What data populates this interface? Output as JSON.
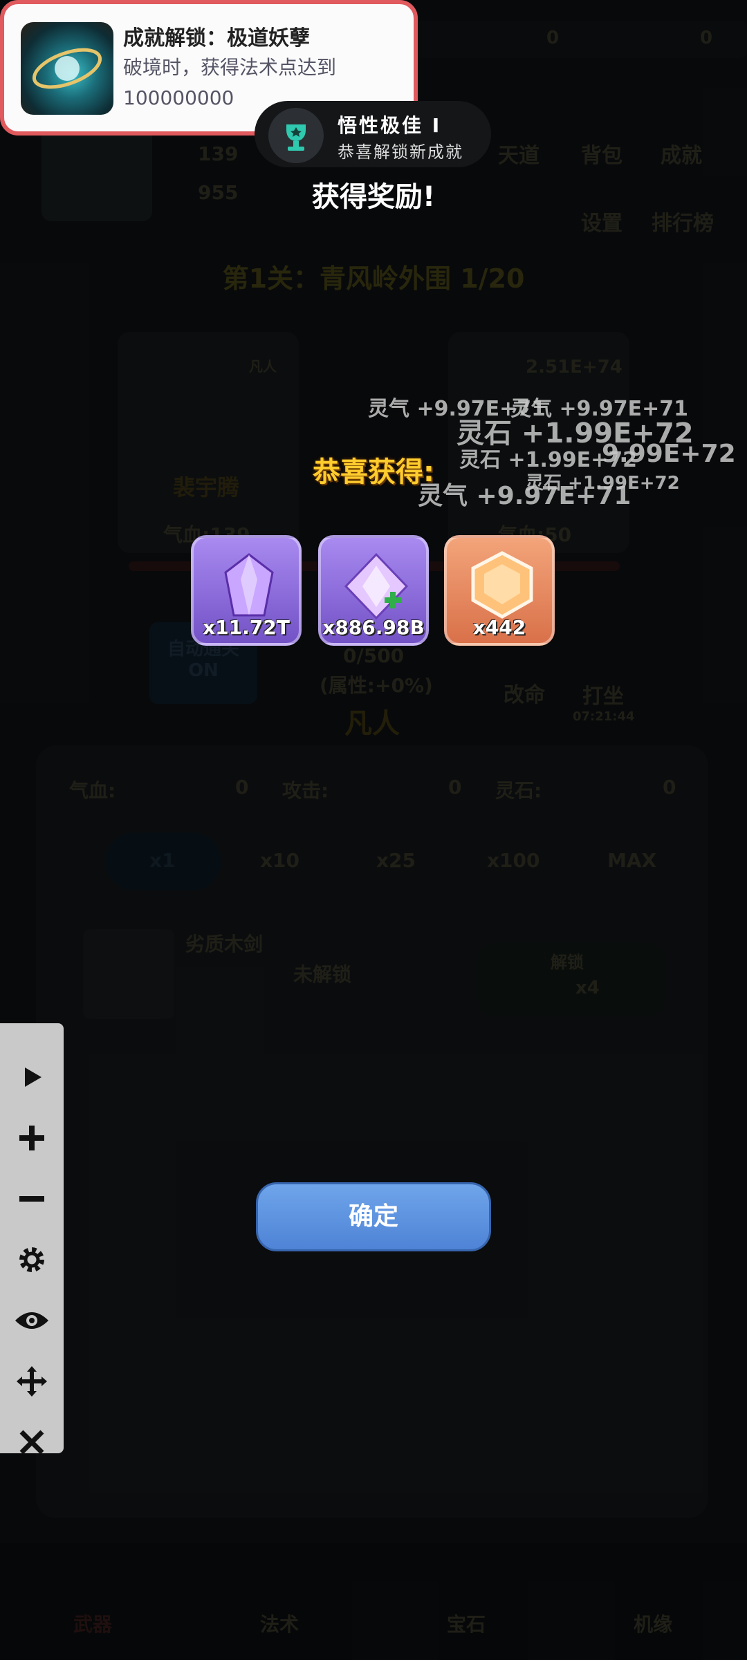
{
  "background": {
    "stage_title": "第1关：青风岭外围 1/20",
    "top_numbers": [
      "0",
      "0"
    ],
    "player_stats": [
      "139",
      "955"
    ],
    "menu": [
      "天道",
      "背包",
      "成就",
      "设置",
      "排行榜"
    ],
    "left_card": {
      "badge": "凡人",
      "name": "裴宇腾",
      "hp": "气血:139"
    },
    "right_card": {
      "level": "2.51E+74",
      "hp": "气血:50"
    },
    "floating_numbers": [
      "灵气 +9.97E+71",
      "灵气 +9.97E+71",
      "灵石 +1.99E+72",
      "灵石 +1.99E+72",
      "9.99E+72",
      "灵气 +9.97E+71",
      "灵石 +1.99E+72"
    ],
    "auto_button": {
      "line1": "自动通关",
      "line2": "ON"
    },
    "progress": "0/500",
    "attr": "(属性:+0%)",
    "realm": "凡人",
    "actions": [
      "改命",
      "打坐"
    ],
    "timer": "07:21:44",
    "stats_row": [
      {
        "label": "气血:",
        "value": "0"
      },
      {
        "label": "攻击:",
        "value": "0"
      },
      {
        "label": "灵石:",
        "value": "0"
      }
    ],
    "multipliers": [
      "x1",
      "x10",
      "x25",
      "x100",
      "MAX"
    ],
    "weapon": {
      "name": "劣质木剑",
      "status": "未解锁",
      "btn": "解锁",
      "cost": "x4"
    },
    "bottom_nav": [
      "武器",
      "法术",
      "宝石",
      "机缘"
    ]
  },
  "toast": {
    "title": "成就解锁：极道妖孽",
    "desc": "破境时，获得法术点达到100000000"
  },
  "pill": {
    "title": "悟性极佳 I",
    "sub": "恭喜解锁新成就"
  },
  "reward": {
    "title": "获得奖励!",
    "congrats": "恭喜获得:",
    "items": [
      {
        "icon": "purple-crystal-icon",
        "count": "x11.72T",
        "color": "#8a63d6"
      },
      {
        "icon": "diamond-plus-icon",
        "count": "x886.98B",
        "color": "#8a63d6"
      },
      {
        "icon": "orange-cube-icon",
        "count": "x442",
        "color": "#e88a54"
      }
    ],
    "confirm": "确定"
  },
  "toolbar": [
    "play-icon",
    "plus-icon",
    "minus-icon",
    "gear-icon",
    "eye-icon",
    "move-icon",
    "close-icon"
  ]
}
